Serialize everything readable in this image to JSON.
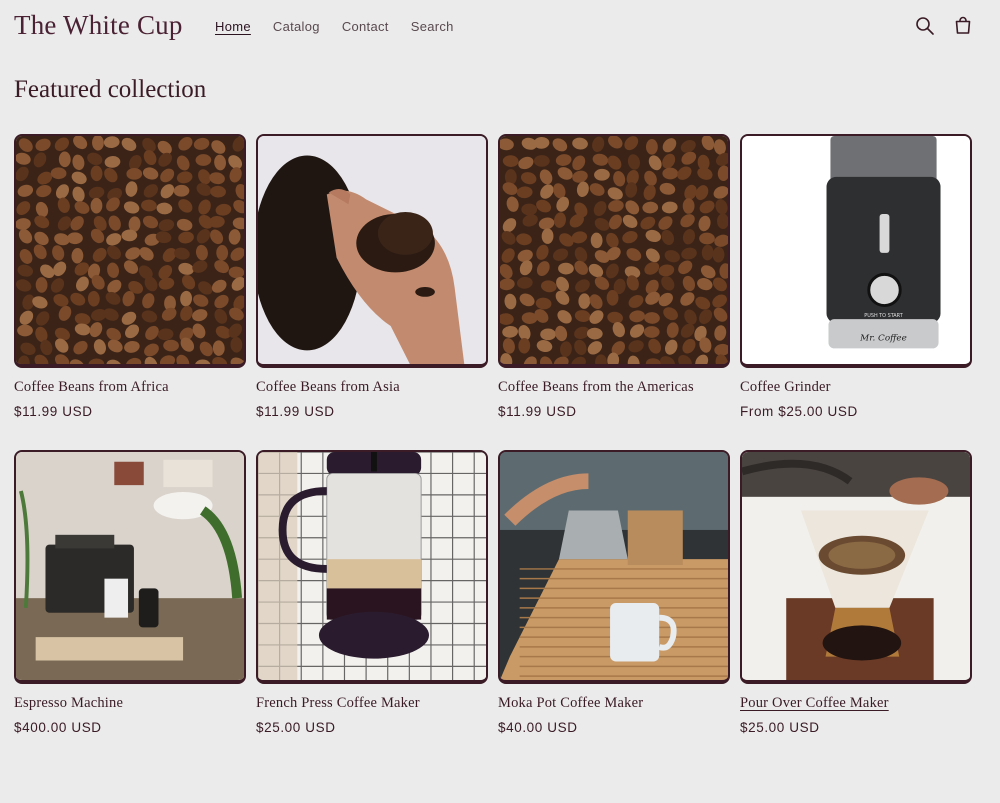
{
  "header": {
    "logo": "The White Cup",
    "nav": [
      {
        "label": "Home",
        "active": true
      },
      {
        "label": "Catalog",
        "active": false
      },
      {
        "label": "Contact",
        "active": false
      },
      {
        "label": "Search",
        "active": false
      }
    ],
    "icons": [
      "search-icon",
      "cart-icon"
    ]
  },
  "main": {
    "title": "Featured collection",
    "products": [
      {
        "title": "Coffee Beans from Africa",
        "price": "$11.99 USD",
        "image": "coffee-beans"
      },
      {
        "title": "Coffee Beans from Asia",
        "price": "$11.99 USD",
        "image": "hand-with-beans"
      },
      {
        "title": "Coffee Beans from the Americas",
        "price": "$11.99 USD",
        "image": "coffee-beans"
      },
      {
        "title": "Coffee Grinder",
        "price": "From $25.00 USD",
        "image": "coffee-grinder",
        "product_label": "Mr. Coffee",
        "button_label": "PUSH TO START"
      },
      {
        "title": "Espresso Machine",
        "price": "$400.00 USD",
        "image": "espresso-machine"
      },
      {
        "title": "French Press Coffee Maker",
        "price": "$25.00 USD",
        "image": "french-press"
      },
      {
        "title": "Moka Pot Coffee Maker",
        "price": "$40.00 USD",
        "image": "moka-pot"
      },
      {
        "title": "Pour Over Coffee Maker",
        "price": "$25.00 USD",
        "image": "pour-over",
        "hovered": true
      }
    ]
  },
  "colors": {
    "background": "#ebebeb",
    "text": "#3a1b26",
    "border": "#3a1b26",
    "muted": "#5a4a50"
  }
}
